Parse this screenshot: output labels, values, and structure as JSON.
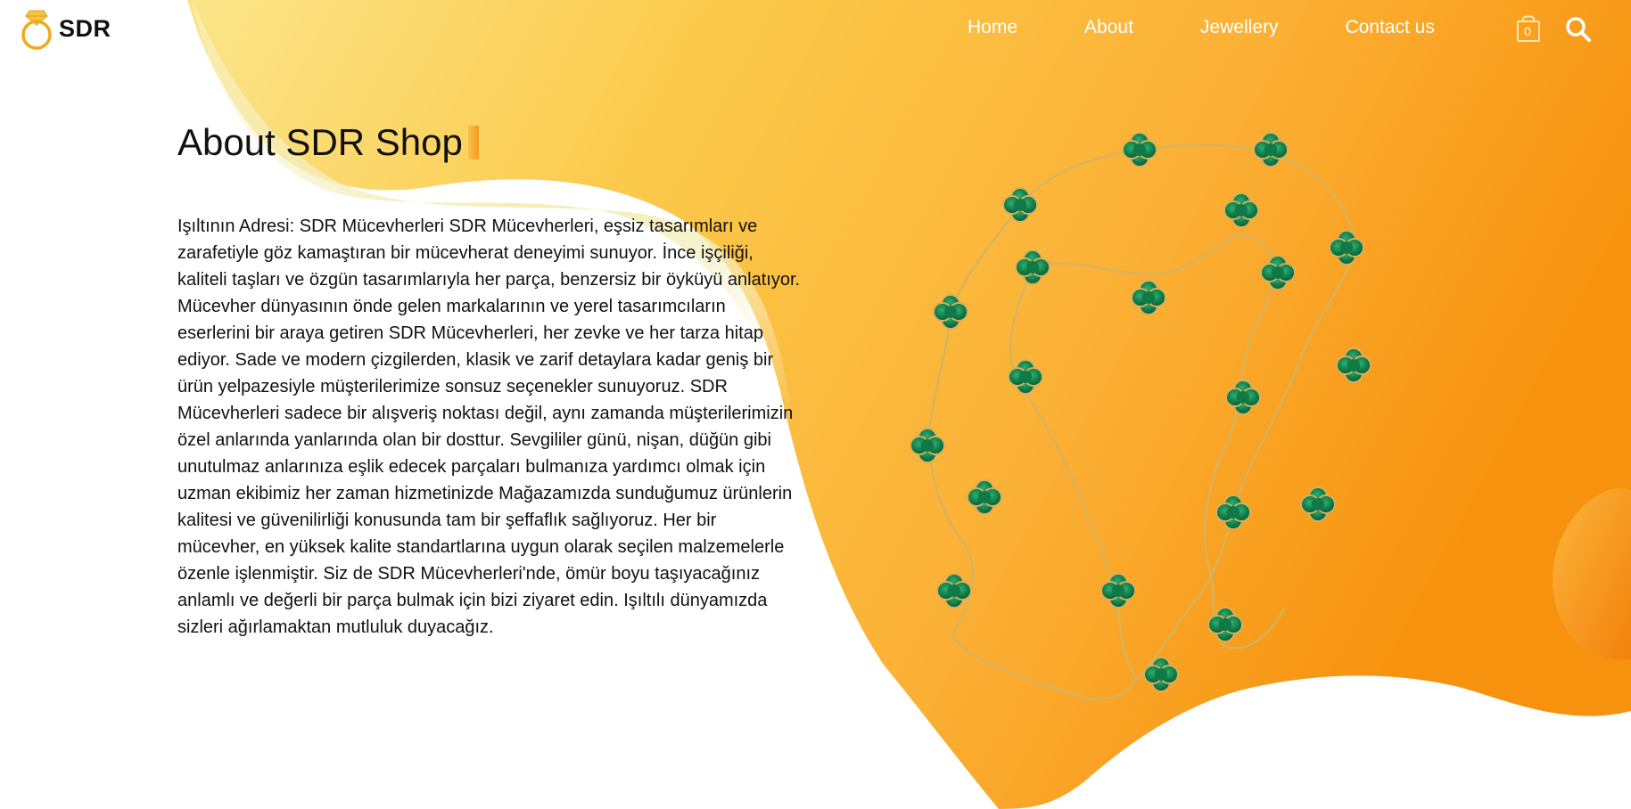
{
  "brand": {
    "name": "SDR",
    "logo_icon": "ring-icon"
  },
  "nav": {
    "items": [
      {
        "label": "Home"
      },
      {
        "label": "About"
      },
      {
        "label": "Jewellery"
      },
      {
        "label": "Contact us"
      }
    ],
    "cart_icon": "shopping-bag-icon",
    "cart_count": "0",
    "search_icon": "search-icon"
  },
  "about": {
    "title": "About SDR Shop",
    "paragraph": "Işıltının Adresi: SDR Mücevherleri SDR Mücevherleri, eşsiz tasarımları ve zarafetiyle göz kamaştıran bir mücevherat deneyimi sunuyor. İnce işçiliği, kaliteli taşları ve özgün tasarımlarıyla her parça, benzersiz bir öyküyü anlatıyor. Mücevher dünyasının önde gelen markalarının ve yerel tasarımcıların eserlerini bir araya getiren SDR Mücevherleri, her zevke ve her tarza hitap ediyor. Sade ve modern çizgilerden, klasik ve zarif detaylara kadar geniş bir ürün yelpazesiyle müşterilerimize sonsuz seçenekler sunuyoruz. SDR Mücevherleri sadece bir alışveriş noktası değil, aynı zamanda müşterilerimizin özel anlarında yanlarında olan bir dosttur. Sevgililer günü, nişan, düğün gibi unutulmaz anlarınıza eşlik edecek parçaları bulmanıza yardımcı olmak için uzman ekibimiz her zaman hizmetinizde Mağazamızda sunduğumuz ürünlerin kalitesi ve güvenilirliği konusunda tam bir şeffaflık sağlıyoruz. Her bir mücevher, en yüksek kalite standartlarına uygun olarak seçilen malzemelerle özenle işlenmiştir. Siz de SDR Mücevherleri'nde, ömür boyu taşıyacağınız anlamlı ve değerli bir parça bulmak için bizi ziyaret edin. Işıltılı dünyamızda sizleri ağırlamaktan mutluluk duyacağız."
  },
  "colors": {
    "accent_orange": "#f7941d",
    "accent_yellow": "#f5df7a",
    "text_dark": "#111111",
    "malachite_green": "#0f7a47",
    "gold_chain": "#c9a24a"
  }
}
